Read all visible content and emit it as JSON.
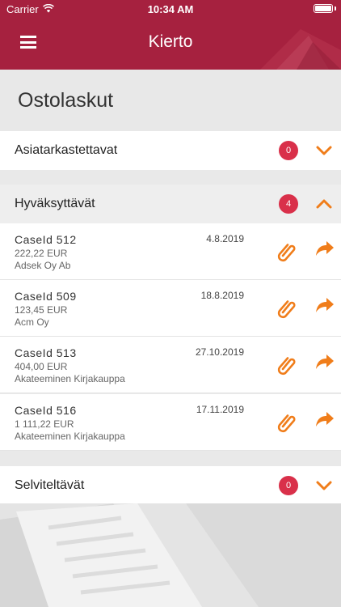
{
  "status_bar": {
    "carrier": "Carrier",
    "time": "10:34 AM"
  },
  "header": {
    "title": "Kierto",
    "menu_icon": "hamburger-menu-icon",
    "color": "#a6213f"
  },
  "page": {
    "title": "Ostolaskut"
  },
  "sections": [
    {
      "label": "Asiatarkastettavat",
      "count": "0",
      "expanded": false
    },
    {
      "label": "Hyväksyttävät",
      "count": "4",
      "expanded": true
    },
    {
      "label": "Selviteltävät",
      "count": "0",
      "expanded": false
    }
  ],
  "cases": [
    {
      "title": "CaseId 512",
      "date": "4.8.2019",
      "amount": "222,22 EUR",
      "company": "Adsek Oy Ab"
    },
    {
      "title": "CaseId 509",
      "date": "18.8.2019",
      "amount": "123,45 EUR",
      "company": "Acm Oy"
    },
    {
      "title": "CaseId 513",
      "date": "27.10.2019",
      "amount": "404,00 EUR",
      "company": "Akateeminen Kirjakauppa"
    },
    {
      "title": "CaseId 516",
      "date": "17.11.2019",
      "amount": "1 111,22 EUR",
      "company": "Akateeminen Kirjakauppa"
    }
  ],
  "colors": {
    "accent": "#f07d1a",
    "badge": "#d9304a",
    "header": "#a6213f"
  }
}
